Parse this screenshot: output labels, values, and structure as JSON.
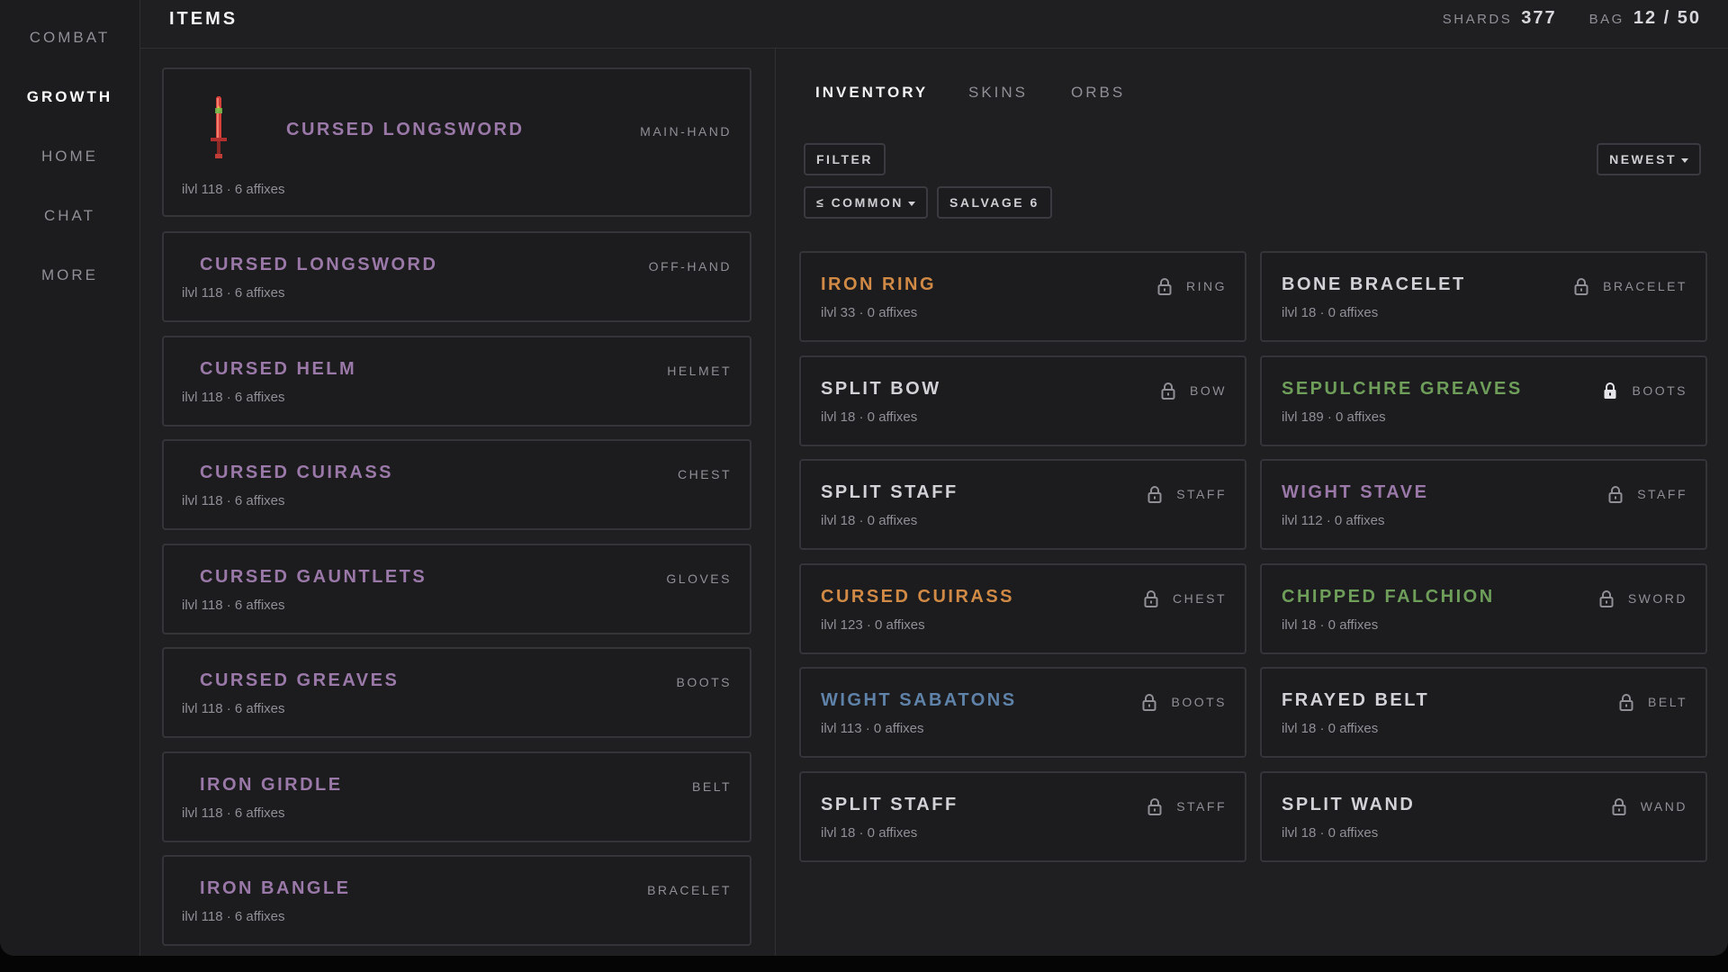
{
  "sidebar": {
    "items": [
      {
        "label": "COMBAT"
      },
      {
        "label": "GROWTH"
      },
      {
        "label": "HOME"
      },
      {
        "label": "CHAT"
      },
      {
        "label": "MORE"
      }
    ],
    "active": "GROWTH"
  },
  "header": {
    "title": "ITEMS",
    "shards_label": "SHARDS",
    "shards_value": "377",
    "bag_label": "BAG",
    "bag_value": "12 / 50"
  },
  "equipped": [
    {
      "name": "CURSED LONGSWORD",
      "slot": "MAIN-HAND",
      "sub": "ilvl 118 · 6 affixes",
      "icon": "sword-icon"
    },
    {
      "name": "CURSED LONGSWORD",
      "slot": "OFF-HAND",
      "sub": "ilvl 118 · 6 affixes"
    },
    {
      "name": "CURSED HELM",
      "slot": "HELMET",
      "sub": "ilvl 118 · 6 affixes"
    },
    {
      "name": "CURSED CUIRASS",
      "slot": "CHEST",
      "sub": "ilvl 118 · 6 affixes"
    },
    {
      "name": "CURSED GAUNTLETS",
      "slot": "GLOVES",
      "sub": "ilvl 118 · 6 affixes"
    },
    {
      "name": "CURSED GREAVES",
      "slot": "BOOTS",
      "sub": "ilvl 118 · 6 affixes"
    },
    {
      "name": "IRON GIRDLE",
      "slot": "BELT",
      "sub": "ilvl 118 · 6 affixes"
    },
    {
      "name": "IRON BANGLE",
      "slot": "BRACELET",
      "sub": "ilvl 118 · 6 affixes"
    }
  ],
  "tabs": [
    {
      "label": "INVENTORY"
    },
    {
      "label": "SKINS"
    },
    {
      "label": "ORBS"
    }
  ],
  "toolbar": {
    "filter_label": "FILTER",
    "sort_label": "NEWEST",
    "rarity_label": "≤ COMMON",
    "salvage_label": "SALVAGE 6"
  },
  "colors": {
    "epic": "#9a78a8",
    "legendary": "#d08a45",
    "set": "#6e9e5a",
    "rare": "#5f82a8",
    "common": "#d2d2d6"
  },
  "inventory": [
    {
      "name": "IRON RING",
      "slot": "RING",
      "sub": "ilvl 33 · 0 affixes",
      "color": "#d08a45",
      "locked": false
    },
    {
      "name": "BONE BRACELET",
      "slot": "BRACELET",
      "sub": "ilvl 18 · 0 affixes",
      "color": "#d2d2d6",
      "locked": false
    },
    {
      "name": "SPLIT BOW",
      "slot": "BOW",
      "sub": "ilvl 18 · 0 affixes",
      "color": "#d2d2d6",
      "locked": false
    },
    {
      "name": "SEPULCHRE GREAVES",
      "slot": "BOOTS",
      "sub": "ilvl 189 · 0 affixes",
      "color": "#6e9e5a",
      "locked": true
    },
    {
      "name": "SPLIT STAFF",
      "slot": "STAFF",
      "sub": "ilvl 18 · 0 affixes",
      "color": "#d2d2d6",
      "locked": false
    },
    {
      "name": "WIGHT STAVE",
      "slot": "STAFF",
      "sub": "ilvl 112 · 0 affixes",
      "color": "#9a78a8",
      "locked": false
    },
    {
      "name": "CURSED CUIRASS",
      "slot": "CHEST",
      "sub": "ilvl 123 · 0 affixes",
      "color": "#d08a45",
      "locked": false
    },
    {
      "name": "CHIPPED FALCHION",
      "slot": "SWORD",
      "sub": "ilvl 18 · 0 affixes",
      "color": "#6e9e5a",
      "locked": false
    },
    {
      "name": "WIGHT SABATONS",
      "slot": "BOOTS",
      "sub": "ilvl 113 · 0 affixes",
      "color": "#5f82a8",
      "locked": false
    },
    {
      "name": "FRAYED BELT",
      "slot": "BELT",
      "sub": "ilvl 18 · 0 affixes",
      "color": "#d2d2d6",
      "locked": false
    },
    {
      "name": "SPLIT STAFF",
      "slot": "STAFF",
      "sub": "ilvl 18 · 0 affixes",
      "color": "#d2d2d6",
      "locked": false
    },
    {
      "name": "SPLIT WAND",
      "slot": "WAND",
      "sub": "ilvl 18 · 0 affixes",
      "color": "#d2d2d6",
      "locked": false
    }
  ]
}
